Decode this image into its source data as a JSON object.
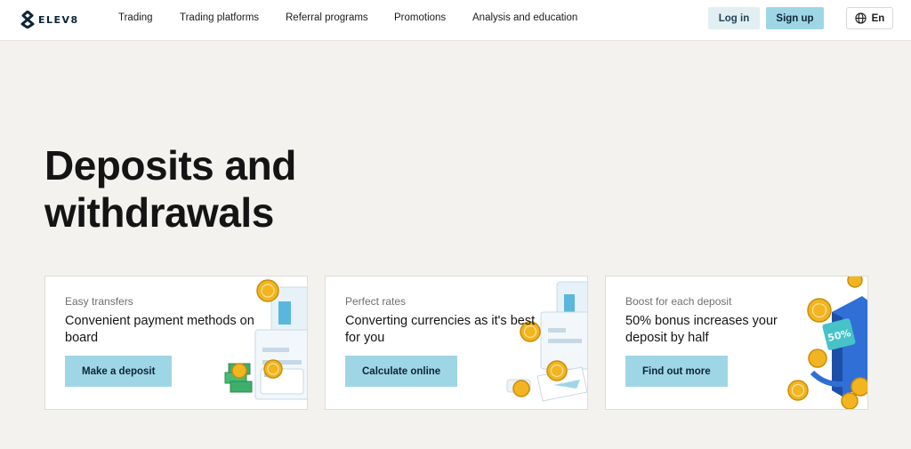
{
  "brand": {
    "name": "ELEV8"
  },
  "nav": {
    "items": [
      {
        "label": "Trading"
      },
      {
        "label": "Trading platforms"
      },
      {
        "label": "Referral programs"
      },
      {
        "label": "Promotions"
      },
      {
        "label": "Analysis and education"
      }
    ]
  },
  "auth": {
    "login_label": "Log in",
    "signup_label": "Sign up"
  },
  "language": {
    "label": "En",
    "icon": "globe-icon"
  },
  "hero": {
    "title_line1": "Deposits and",
    "title_line2": "withdrawals"
  },
  "cards": [
    {
      "eyebrow": "Easy transfers",
      "title": "Convenient payment methods on board",
      "button": "Make a deposit",
      "illustration": "payment-card-coins-illustration"
    },
    {
      "eyebrow": "Perfect rates",
      "title": "Converting currencies as it's best for you",
      "button": "Calculate online",
      "illustration": "credit-card-coins-illustration"
    },
    {
      "eyebrow": "Boost for each deposit",
      "title": "50% bonus increases your deposit by half",
      "button": "Find out more",
      "illustration": "bonus-gift-coins-illustration",
      "art_badge": "50%"
    }
  ],
  "colors": {
    "background": "#f3f2ef",
    "accent": "#9fd6e6",
    "login_bg": "#e1eff3",
    "coin": "#f2b51f",
    "text_dark": "#141414"
  }
}
